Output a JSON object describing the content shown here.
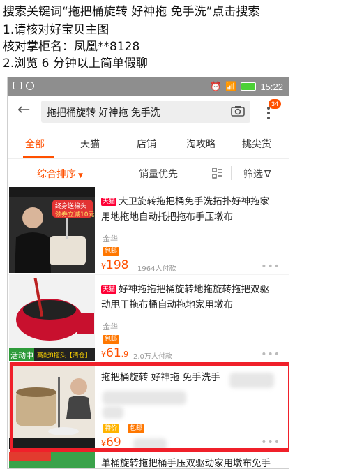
{
  "instructions": {
    "line1": "搜索关键词“拖把桶旋转 好神拖 免手洗”点击搜索",
    "line2": "1.请核对好宝贝主图",
    "line3": "核对掌柜名：凤凰**8128",
    "line4": "2.浏览 6 分钟以上简单假聊"
  },
  "status_bar": {
    "time": "15:22"
  },
  "search": {
    "query": "拖把桶旋转 好神拖 免手洗",
    "message_count": "34"
  },
  "tabs": [
    "全部",
    "天猫",
    "店铺",
    "淘攻略",
    "挑尖货"
  ],
  "active_tab": 0,
  "sort": {
    "comprehensive": "综合排序",
    "sales": "销量优先",
    "filter": "筛选"
  },
  "products": [
    {
      "badge": "天猫",
      "title": "大卫旋转拖把桶免手洗拓扑好神拖家用地拖地自动托把拖布手压墩布",
      "shop": "金华",
      "shipping": "包邮",
      "price": "198",
      "sales": "1964人付款",
      "image_text": [
        "终身送棉头",
        "领券立减10元"
      ]
    },
    {
      "badge": "天猫",
      "title": "好神拖拖把桶旋转地拖旋转拖把双驱动甩干拖布桶自动拖地家用墩布",
      "shop": "金华",
      "shipping": "包邮",
      "price": "61",
      "price_decimal": ".9",
      "sales": "2.0万人付款",
      "image_text": [
        "活动中",
        "高配8拖头【清仓】"
      ]
    },
    {
      "badge": "",
      "title": "拖把桶旋转 好神拖 免手洗手",
      "shop": "",
      "shipping_tags": [
        "特价",
        "包邮"
      ],
      "price": "69",
      "sales": ""
    }
  ],
  "next_item_title": "单桶旋转拖把桶手压双驱动家用墩布免手",
  "colors": {
    "accent": "#ff5000",
    "highlight": "#f0202a",
    "tmall": "#ff0036"
  },
  "icons": [
    "back-arrow-icon",
    "camera-icon",
    "more-icon",
    "grid-view-icon",
    "filter-icon",
    "wifi-icon",
    "battery-icon"
  ]
}
